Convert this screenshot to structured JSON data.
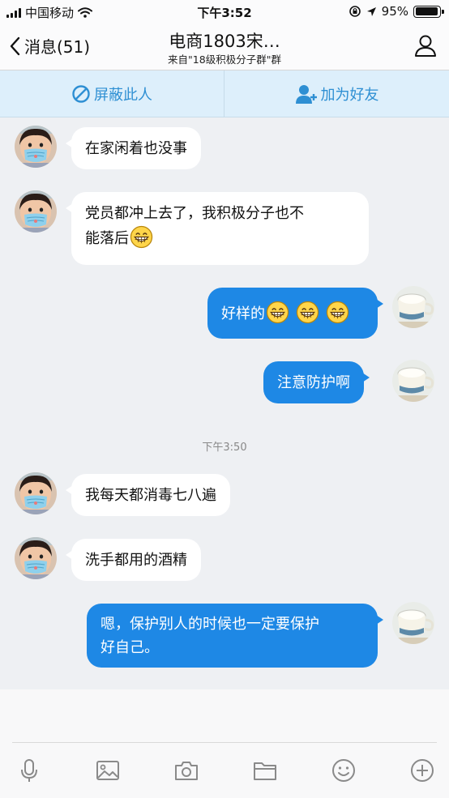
{
  "status_bar": {
    "carrier": "中国移动",
    "time": "下午3:52",
    "battery": "95%"
  },
  "nav": {
    "back_label": "消息(51)",
    "title": "电商1803宋…",
    "subtitle": "来自\"18级积极分子群\"群"
  },
  "actions": {
    "block_label": "屏蔽此人",
    "add_friend_label": "加为好友"
  },
  "messages": [
    {
      "direction": "in",
      "text": "在家闲着也没事"
    },
    {
      "direction": "in",
      "line1": "党员都冲上去了，我积极分子也不",
      "line2": "能落后",
      "emoji_count": 1
    },
    {
      "direction": "out",
      "text": "好样的",
      "emoji_count": 3
    },
    {
      "direction": "out",
      "text": "注意防护啊"
    },
    {
      "direction": "in",
      "text": "我每天都消毒七八遍"
    },
    {
      "direction": "in",
      "text": "洗手都用的酒精"
    },
    {
      "direction": "out",
      "line1": "嗯，保护别人的时候也一定要保护",
      "line2": "好自己。"
    }
  ],
  "timestamp": "下午3:50",
  "toolbar": [
    "mic-icon",
    "image-icon",
    "camera-icon",
    "folder-icon",
    "emoji-icon",
    "plus-icon"
  ],
  "colors": {
    "accent": "#1e88e5",
    "link": "#2e8fd3",
    "action_bar_bg": "#ddeffb",
    "chat_bg": "#eef0f3"
  }
}
